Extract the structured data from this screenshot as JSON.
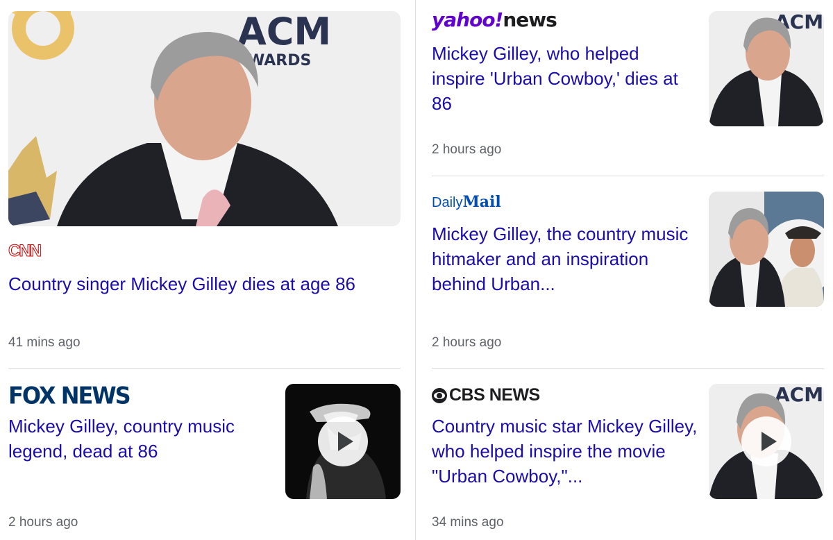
{
  "stories": [
    {
      "source": "CNN",
      "headline": "Country singer Mickey Gilley dies at age 86",
      "time": "41 mins ago",
      "thumbnail": "mickey-gilley-photo"
    },
    {
      "source_brand": "yahoo!",
      "source_suffix": "news",
      "headline": "Mickey Gilley, who helped inspire 'Urban Cowboy,' dies at 86",
      "time": "2 hours ago",
      "thumbnail": "mickey-gilley-photo"
    },
    {
      "source_brand": "Daily",
      "source_suffix": "Mail",
      "headline": "Mickey Gilley, the country music hitmaker and an inspiration behind Urban...",
      "time": "2 hours ago",
      "thumbnail": "mickey-gilley-collage-photo"
    },
    {
      "source": "FOX NEWS",
      "headline": "Mickey Gilley, country music legend, dead at 86",
      "time": "2 hours ago",
      "thumbnail": "mickey-gilley-video-thumbnail"
    },
    {
      "source": "CBS NEWS",
      "headline": "Country music star Mickey Gilley, who helped inspire the movie \"Urban Cowboy,\"...",
      "time": "34 mins ago",
      "thumbnail": "mickey-gilley-video-thumbnail"
    }
  ],
  "colors": {
    "headline": "#1a0dab",
    "timestamp": "#5f6368",
    "divider": "#dadce0",
    "cnn": "#cc0000",
    "yahoo": "#6001d2",
    "daily_mail": "#004db3",
    "fox": "#003366"
  }
}
